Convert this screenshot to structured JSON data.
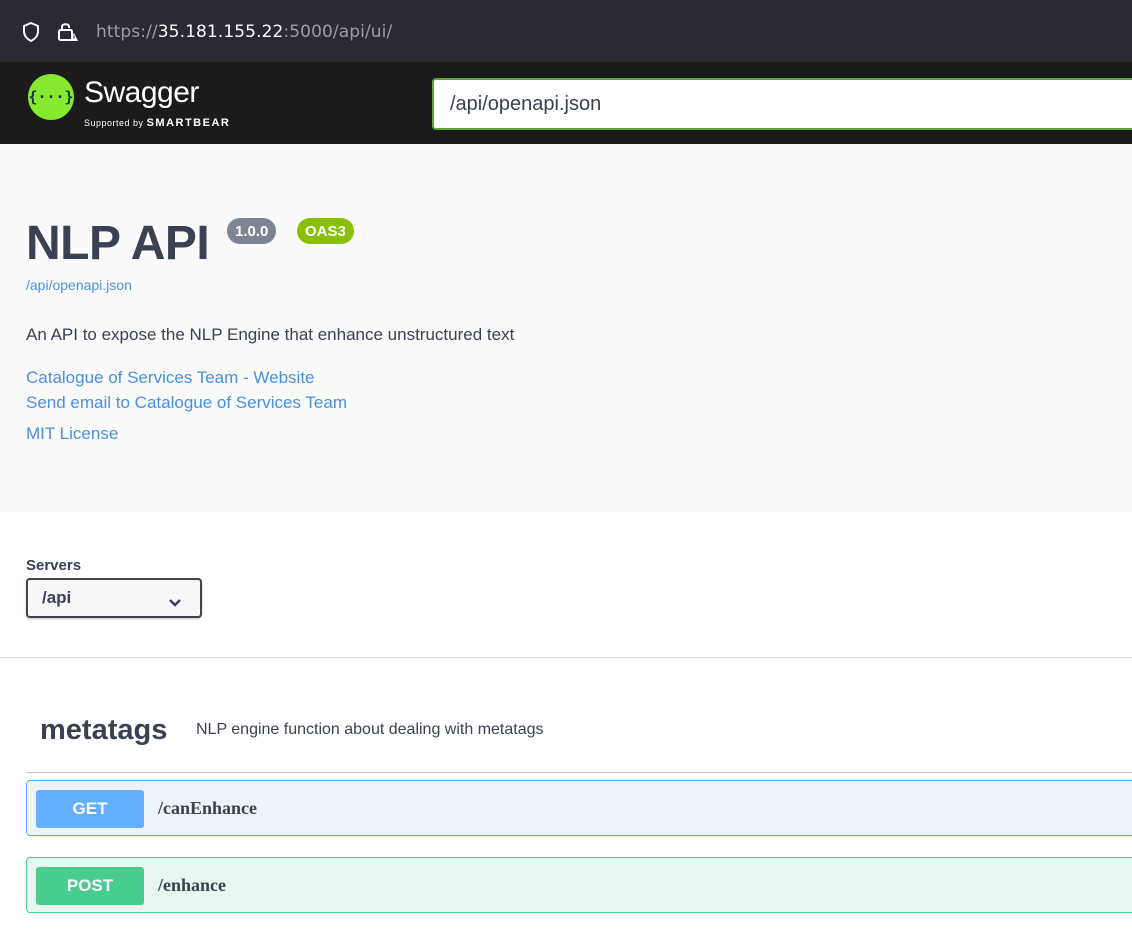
{
  "browser": {
    "url_protocol": "https://",
    "url_host": "35.181.155.22",
    "url_rest": ":5000/api/ui/"
  },
  "topbar": {
    "logo_glyph": "{···}",
    "logo_text": "Swagger",
    "logo_sub_prefix": "Supported by",
    "logo_sub_brand": "SMARTBEAR",
    "spec_url": "/api/openapi.json",
    "colors": {
      "accent": "#85ea2d",
      "background": "#1b1b1b"
    }
  },
  "info": {
    "title": "NLP API",
    "version": "1.0.0",
    "oas_badge": "OAS3",
    "spec_link": "/api/openapi.json",
    "description": "An API to expose the NLP Engine that enhance unstructured text",
    "links": [
      "Catalogue of Services Team - Website",
      "Send email to Catalogue of Services Team",
      "MIT License"
    ]
  },
  "servers": {
    "label": "Servers",
    "selected": "/api"
  },
  "tag": {
    "name": "metatags",
    "description": "NLP engine function about dealing with metatags"
  },
  "operations": [
    {
      "method": "GET",
      "path": "/canEnhance",
      "color": "#61affe"
    },
    {
      "method": "POST",
      "path": "/enhance",
      "color": "#49cc90"
    }
  ]
}
